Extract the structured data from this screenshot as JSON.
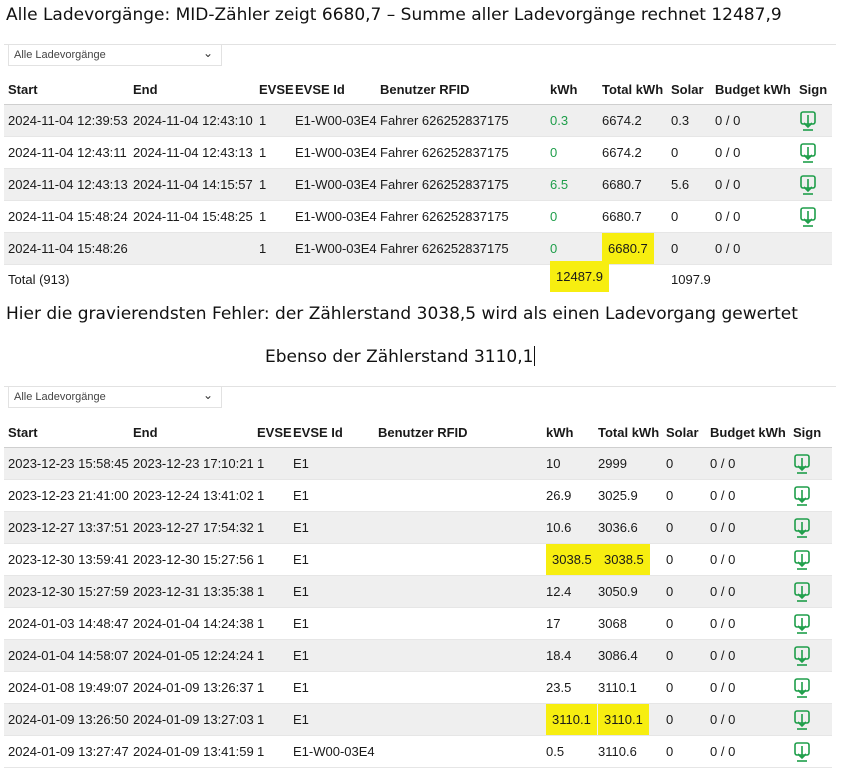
{
  "notes": {
    "line1": "Alle Ladevorgänge: MID-Zähler zeigt 6680,7 – Summe aller Ladevorgänge rechnet 12487,9",
    "line2": "Hier die gravierendsten Fehler: der Zählerstand 3038,5 wird als einen Ladevorgang gewertet",
    "line3": "Ebenso der Zählerstand 3110,1"
  },
  "columns": [
    "Start",
    "End",
    "EVSE",
    "EVSE Id",
    "Benutzer RFID",
    "kWh",
    "Total kWh",
    "Solar",
    "Budget kWh",
    "Sign"
  ],
  "panel1": {
    "filter_value": "Alle Ladevorgänge",
    "rows": [
      {
        "start": "2024-11-04 12:39:53",
        "end": "2024-11-04 12:43:10",
        "evse": "1",
        "evse_id": "E1-W00-03E4",
        "rfid": "Fahrer 626252837175",
        "kwh": "0.3",
        "total": "6674.2",
        "solar": "0.3",
        "budget": "0 / 0",
        "sign": true
      },
      {
        "start": "2024-11-04 12:43:11",
        "end": "2024-11-04 12:43:13",
        "evse": "1",
        "evse_id": "E1-W00-03E4",
        "rfid": "Fahrer 626252837175",
        "kwh": "0",
        "total": "6674.2",
        "solar": "0",
        "budget": "0 / 0",
        "sign": true
      },
      {
        "start": "2024-11-04 12:43:13",
        "end": "2024-11-04 14:15:57",
        "evse": "1",
        "evse_id": "E1-W00-03E4",
        "rfid": "Fahrer 626252837175",
        "kwh": "6.5",
        "total": "6680.7",
        "solar": "5.6",
        "budget": "0 / 0",
        "sign": true
      },
      {
        "start": "2024-11-04 15:48:24",
        "end": "2024-11-04 15:48:25",
        "evse": "1",
        "evse_id": "E1-W00-03E4",
        "rfid": "Fahrer 626252837175",
        "kwh": "0",
        "total": "6680.7",
        "solar": "0",
        "budget": "0 / 0",
        "sign": true
      },
      {
        "start": "2024-11-04 15:48:26",
        "end": "",
        "evse": "1",
        "evse_id": "E1-W00-03E4",
        "rfid": "Fahrer 626252837175",
        "kwh": "0",
        "total": "6680.7",
        "solar": "0",
        "budget": "0 / 0",
        "sign": false
      }
    ],
    "total": {
      "label": "Total (913)",
      "kwh": "12487.9",
      "solar": "1097.9"
    }
  },
  "panel2": {
    "filter_value": "Alle Ladevorgänge",
    "rows": [
      {
        "start": "2023-12-23 15:58:45",
        "end": "2023-12-23 17:10:21",
        "evse": "1",
        "evse_id": "E1",
        "rfid": "",
        "kwh": "10",
        "total": "2999",
        "solar": "0",
        "budget": "0 / 0",
        "sign": true
      },
      {
        "start": "2023-12-23 21:41:00",
        "end": "2023-12-24 13:41:02",
        "evse": "1",
        "evse_id": "E1",
        "rfid": "",
        "kwh": "26.9",
        "total": "3025.9",
        "solar": "0",
        "budget": "0 / 0",
        "sign": true
      },
      {
        "start": "2023-12-27 13:37:51",
        "end": "2023-12-27 17:54:32",
        "evse": "1",
        "evse_id": "E1",
        "rfid": "",
        "kwh": "10.6",
        "total": "3036.6",
        "solar": "0",
        "budget": "0 / 0",
        "sign": true
      },
      {
        "start": "2023-12-30 13:59:41",
        "end": "2023-12-30 15:27:56",
        "evse": "1",
        "evse_id": "E1",
        "rfid": "",
        "kwh": "3038.5",
        "total": "3038.5",
        "solar": "0",
        "budget": "0 / 0",
        "sign": true
      },
      {
        "start": "2023-12-30 15:27:59",
        "end": "2023-12-31 13:35:38",
        "evse": "1",
        "evse_id": "E1",
        "rfid": "",
        "kwh": "12.4",
        "total": "3050.9",
        "solar": "0",
        "budget": "0 / 0",
        "sign": true
      },
      {
        "start": "2024-01-03 14:48:47",
        "end": "2024-01-04 14:24:38",
        "evse": "1",
        "evse_id": "E1",
        "rfid": "",
        "kwh": "17",
        "total": "3068",
        "solar": "0",
        "budget": "0 / 0",
        "sign": true
      },
      {
        "start": "2024-01-04 14:58:07",
        "end": "2024-01-05 12:24:24",
        "evse": "1",
        "evse_id": "E1",
        "rfid": "",
        "kwh": "18.4",
        "total": "3086.4",
        "solar": "0",
        "budget": "0 / 0",
        "sign": true
      },
      {
        "start": "2024-01-08 19:49:07",
        "end": "2024-01-09 13:26:37",
        "evse": "1",
        "evse_id": "E1",
        "rfid": "",
        "kwh": "23.5",
        "total": "3110.1",
        "solar": "0",
        "budget": "0 / 0",
        "sign": true
      },
      {
        "start": "2024-01-09 13:26:50",
        "end": "2024-01-09 13:27:03",
        "evse": "1",
        "evse_id": "E1",
        "rfid": "",
        "kwh": "3110.1",
        "total": "3110.1",
        "solar": "0",
        "budget": "0 / 0",
        "sign": true
      },
      {
        "start": "2024-01-09 13:27:47",
        "end": "2024-01-09 13:41:59",
        "evse": "1",
        "evse_id": "E1-W00-03E4",
        "rfid": "",
        "kwh": "0.5",
        "total": "3110.6",
        "solar": "0",
        "budget": "0 / 0",
        "sign": true
      }
    ]
  },
  "colors": {
    "green": "#1e9e4a",
    "highlight": "#f7ee10",
    "row_alt": "#efefef"
  },
  "icons": {
    "sign": "download-signature-icon",
    "dropdown": "chevron-down-icon"
  }
}
